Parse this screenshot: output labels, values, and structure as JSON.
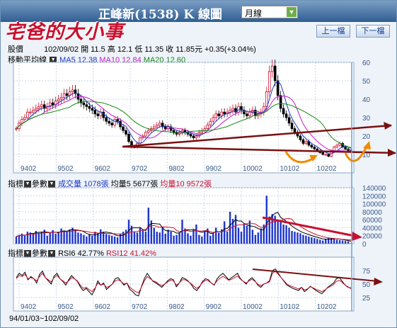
{
  "header": {
    "title": "正峰新(1538) K 線圖",
    "period_value": "月線",
    "watermark": "宅爸的大小事",
    "prev_label": "上一檔",
    "next_label": "下一檔"
  },
  "quote": {
    "label": "股價",
    "date": "102/09/02",
    "open_label": "開",
    "open": "11.5",
    "high_label": "高",
    "high": "12.1",
    "low_label": "低",
    "low": "11.35",
    "close_label": "收",
    "close": "11.85元",
    "change": "+0.35(+3.04%)"
  },
  "ma_legend": {
    "label": "移動平均線",
    "ma5": "MA5 12.38",
    "ma10": "MA10 12.84",
    "ma20": "MA20 12.60"
  },
  "vol_legend": {
    "indicator_label": "指標",
    "param_label": "參數",
    "vol": "成交量 1078張",
    "vol5": "均量5 5677張",
    "vol10": "均量10 9572張"
  },
  "rsi_legend": {
    "indicator_label": "指標",
    "param_label": "參數",
    "rsi6": "RSI6 42.77%",
    "rsi12": "RSI12 41.42%"
  },
  "footer": {
    "range": "94/01/03~102/09/02"
  },
  "colors": {
    "up": "#c8102e",
    "down": "#000000",
    "volume": "#1d35c8",
    "annotation": "#7a1010",
    "annotation_orange": "#f08a00"
  },
  "chart_data": [
    {
      "type": "candlestick",
      "title": "正峰新(1538) K 線圖",
      "x_ticks": [
        "9402",
        "9502",
        "9602",
        "9702",
        "9802",
        "9902",
        "10002",
        "10102",
        "10202"
      ],
      "ylim": [
        0,
        60
      ],
      "y_ticks": [
        10,
        20,
        30,
        40,
        50,
        60
      ],
      "grid": true,
      "series_close": [
        24,
        27,
        29,
        30,
        33,
        33,
        34,
        35,
        36,
        37,
        35,
        36,
        38,
        37,
        39,
        40,
        41,
        43,
        42,
        44,
        45,
        43,
        40,
        38,
        37,
        36,
        35,
        34,
        32,
        31,
        33,
        30,
        28,
        27,
        26,
        29,
        28,
        25,
        23,
        21,
        17,
        14,
        14,
        16,
        19,
        20,
        22,
        23,
        24,
        25,
        26,
        27,
        25,
        24,
        25,
        23,
        22,
        21,
        22,
        23,
        22,
        21,
        20,
        19,
        20,
        22,
        23,
        24,
        26,
        28,
        30,
        32,
        31,
        33,
        32,
        33,
        34,
        35,
        33,
        36,
        34,
        32,
        31,
        33,
        34,
        31,
        32,
        33,
        36,
        44,
        55,
        58,
        50,
        42,
        35,
        32,
        30,
        27,
        24,
        22,
        20,
        18,
        16,
        17,
        15,
        14,
        13,
        12,
        11,
        10,
        10,
        9,
        12,
        14,
        15,
        16,
        14,
        13,
        12,
        11.85
      ],
      "ma_lines": [
        "MA5",
        "MA10",
        "MA20"
      ]
    },
    {
      "type": "bar",
      "title": "成交量",
      "ylim": [
        0,
        140000
      ],
      "y_ticks": [
        0,
        20000,
        40000,
        60000,
        80000,
        100000,
        120000,
        140000
      ],
      "values": [
        18000,
        22000,
        25000,
        20000,
        30000,
        28000,
        26000,
        32000,
        27000,
        30000,
        35000,
        20000,
        28000,
        34000,
        25000,
        30000,
        38000,
        33000,
        30000,
        36000,
        40000,
        34000,
        28000,
        26000,
        22000,
        18000,
        24000,
        20000,
        30000,
        26000,
        36000,
        30000,
        24000,
        22000,
        20000,
        18000,
        16000,
        24000,
        30000,
        35000,
        60000,
        45000,
        30000,
        28000,
        40000,
        35000,
        30000,
        90000,
        58000,
        40000,
        30000,
        28000,
        42000,
        25000,
        35000,
        30000,
        20000,
        22000,
        28000,
        60000,
        38000,
        26000,
        20000,
        35000,
        48000,
        22000,
        18000,
        30000,
        38000,
        20000,
        26000,
        40000,
        28000,
        36000,
        56000,
        30000,
        80000,
        62000,
        72000,
        40000,
        30000,
        50000,
        45000,
        58000,
        35000,
        22000,
        28000,
        38000,
        48000,
        120000,
        68000,
        74000,
        70000,
        60000,
        55000,
        48000,
        46000,
        40000,
        32000,
        30000,
        28000,
        26000,
        22000,
        20000,
        18000,
        16000,
        14000,
        12000,
        10000,
        8000,
        12000,
        15000,
        14000,
        11000,
        10000,
        9000,
        8000,
        7000,
        6000,
        1078
      ],
      "series": [
        {
          "name": "均量5"
        },
        {
          "name": "均量10"
        }
      ]
    },
    {
      "type": "line",
      "title": "RSI",
      "ylim": [
        0,
        100
      ],
      "y_ticks": [
        25,
        50,
        75
      ],
      "series": [
        {
          "name": "RSI6",
          "values": [
            62,
            70,
            66,
            72,
            58,
            64,
            60,
            52,
            68,
            74,
            62,
            56,
            50,
            65,
            70,
            60,
            55,
            48,
            58,
            66,
            60,
            55,
            45,
            38,
            42,
            36,
            30,
            40,
            56,
            48,
            52,
            40,
            45,
            50,
            60,
            62,
            55,
            48,
            52,
            40,
            36,
            30,
            28,
            45,
            60,
            70,
            62,
            55,
            52,
            48,
            44,
            50,
            56,
            60,
            58,
            45,
            52,
            62,
            60,
            56,
            50,
            42,
            38,
            45,
            55,
            60,
            58,
            52,
            48,
            60,
            66,
            70,
            64,
            58,
            62,
            66,
            70,
            60,
            55,
            50,
            58,
            62,
            56,
            48,
            44,
            50,
            52,
            56,
            75,
            78,
            70,
            62,
            55,
            48,
            45,
            42,
            40,
            38,
            44,
            36,
            40,
            46,
            42,
            38,
            35,
            32,
            38,
            44,
            48,
            52,
            60,
            62,
            55,
            48,
            44,
            42.77
          ]
        },
        {
          "name": "RSI12",
          "values": [
            60,
            66,
            64,
            68,
            60,
            62,
            60,
            56,
            64,
            70,
            62,
            58,
            54,
            62,
            66,
            60,
            56,
            52,
            56,
            62,
            60,
            56,
            48,
            42,
            44,
            40,
            36,
            42,
            52,
            48,
            50,
            44,
            46,
            50,
            56,
            58,
            55,
            50,
            52,
            44,
            40,
            36,
            34,
            44,
            56,
            64,
            60,
            56,
            54,
            50,
            47,
            50,
            54,
            57,
            56,
            48,
            52,
            58,
            58,
            55,
            51,
            46,
            42,
            46,
            53,
            57,
            56,
            52,
            49,
            56,
            61,
            64,
            61,
            57,
            59,
            62,
            65,
            59,
            55,
            52,
            56,
            59,
            55,
            50,
            47,
            50,
            52,
            54,
            70,
            74,
            68,
            62,
            56,
            50,
            47,
            45,
            43,
            41,
            44,
            39,
            41,
            45,
            43,
            40,
            38,
            36,
            39,
            43,
            46,
            49,
            55,
            57,
            53,
            48,
            45,
            41.42
          ]
        }
      ]
    }
  ]
}
